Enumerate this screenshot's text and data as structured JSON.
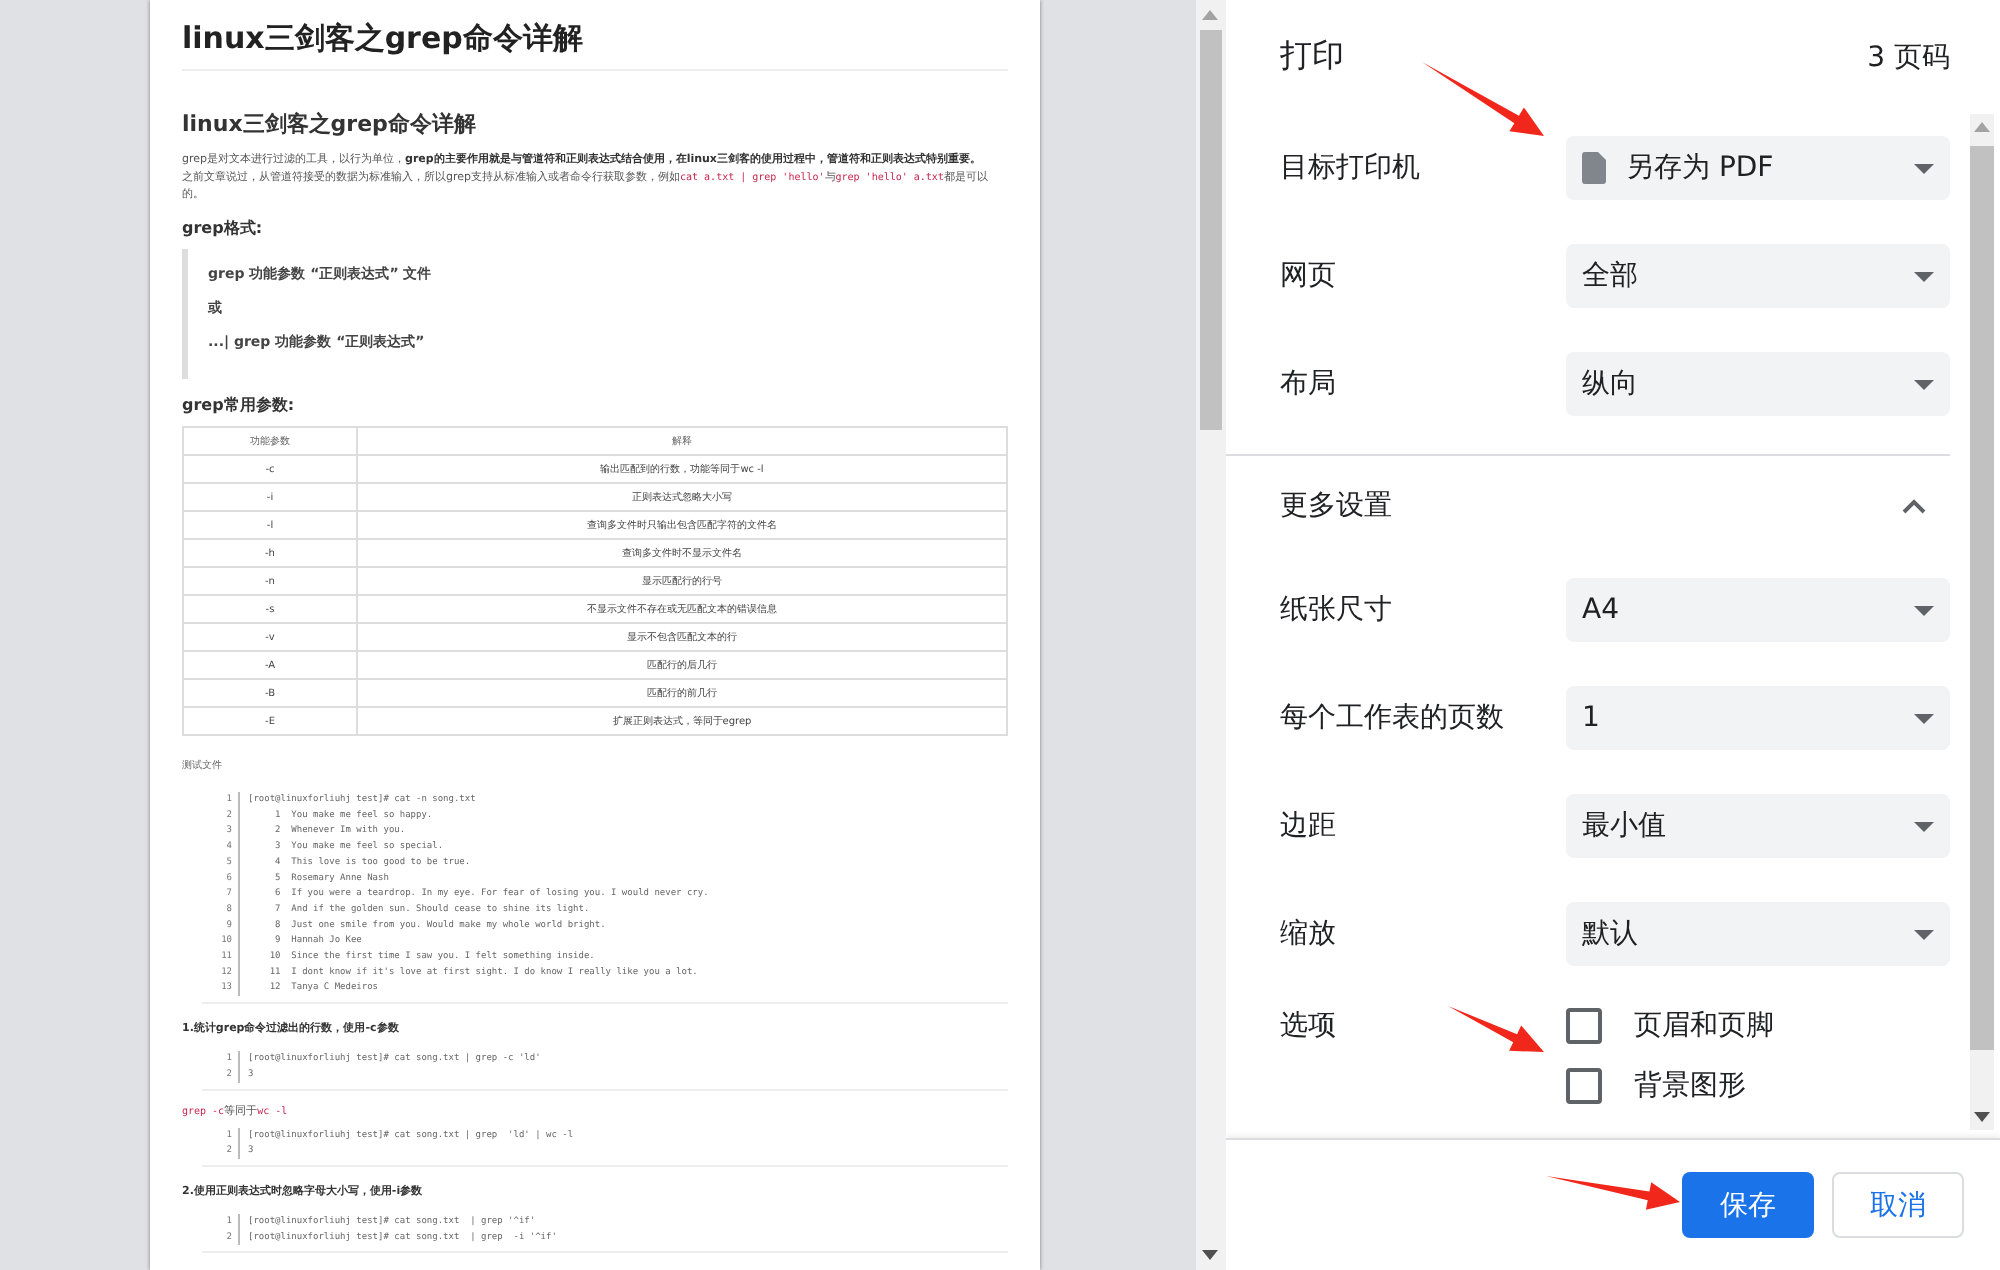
{
  "preview": {
    "title": "linux三剑客之grep命令详解",
    "blocks": [
      {
        "kind": "heading",
        "text": "linux三剑客之grep命令详解"
      },
      {
        "kind": "paragraph",
        "parts": [
          {
            "kind": "text",
            "text": "grep是对文本进行过滤的工具，以行为单位，"
          },
          {
            "kind": "bold",
            "text": "grep的主要作用就是与管道符和正则表达式结合使用，在linux三剑客的使用过程中，管道符和正则表达式特别重要。"
          }
        ]
      },
      {
        "kind": "paragraph",
        "parts": [
          {
            "kind": "text",
            "text": "之前文章说过，从管道符接受的数据为标准输入，所以grep支持从标准输入或者命令行获取参数，例如"
          },
          {
            "kind": "code",
            "text": "cat a.txt | grep 'hello'"
          },
          {
            "kind": "text",
            "text": "与"
          },
          {
            "kind": "code",
            "text": "grep 'hello' a.txt"
          },
          {
            "kind": "text",
            "text": "都是可以的。"
          }
        ]
      },
      {
        "kind": "subheading",
        "text": "grep格式:"
      },
      {
        "kind": "quote",
        "lines": [
          "grep 功能参数 “正则表达式” 文件",
          "或",
          "...| grep 功能参数 “正则表达式”"
        ]
      },
      {
        "kind": "subheading",
        "text": "grep常用参数:"
      },
      {
        "kind": "table",
        "columns": [
          "功能参数",
          "解释"
        ],
        "rows": [
          [
            "-c",
            "输出匹配到的行数，功能等同于wc -l"
          ],
          [
            "-i",
            "正则表达式忽略大小写"
          ],
          [
            "-l",
            "查询多文件时只输出包含匹配字符的文件名"
          ],
          [
            "-h",
            "查询多文件时不显示文件名"
          ],
          [
            "-n",
            "显示匹配行的行号"
          ],
          [
            "-s",
            "不显示文件不存在或无匹配文本的错误信息"
          ],
          [
            "-v",
            "显示不包含匹配文本的行"
          ],
          [
            "-A",
            "匹配行的后几行"
          ],
          [
            "-B",
            "匹配行的前几行"
          ],
          [
            "-E",
            "扩展正则表达式，等同于egrep"
          ]
        ]
      },
      {
        "kind": "caption",
        "text": "测试文件"
      },
      {
        "kind": "code",
        "lines": [
          {
            "n": "1",
            "text": "[root@linuxforliuhj test]# cat -n song.txt"
          },
          {
            "n": "2",
            "text": "     1  You make me feel so happy."
          },
          {
            "n": "3",
            "text": "     2  Whenever Im with you."
          },
          {
            "n": "4",
            "text": "     3  You make me feel so special."
          },
          {
            "n": "5",
            "text": "     4  This love is too good to be true."
          },
          {
            "n": "6",
            "text": "     5  Rosemary Anne Nash"
          },
          {
            "n": "7",
            "text": "     6  If you were a teardrop. In my eye. For fear of losing you. I would never cry."
          },
          {
            "n": "8",
            "text": "     7  And if the golden sun. Should cease to shine its light."
          },
          {
            "n": "9",
            "text": "     8  Just one smile from you. Would make my whole world bright."
          },
          {
            "n": "10",
            "text": "     9  Hannah Jo Kee"
          },
          {
            "n": "11",
            "text": "    10  Since the first time I saw you. I felt something inside."
          },
          {
            "n": "12",
            "text": "    11  I dont know if it's love at first sight. I do know I really like you a lot."
          },
          {
            "n": "13",
            "text": "    12  Tanya C Medeiros"
          }
        ]
      },
      {
        "kind": "step",
        "text": "1.统计grep命令过滤出的行数，使用-c参数"
      },
      {
        "kind": "code",
        "lines": [
          {
            "n": "1",
            "text": "[root@linuxforliuhj test]# cat song.txt | grep -c 'ld'"
          },
          {
            "n": "2",
            "text": "3"
          }
        ]
      },
      {
        "kind": "paragraph",
        "parts": [
          {
            "kind": "code",
            "text": "grep -c"
          },
          {
            "kind": "text",
            "text": "等同于"
          },
          {
            "kind": "code",
            "text": "wc -l"
          }
        ]
      },
      {
        "kind": "code",
        "lines": [
          {
            "n": "1",
            "text": "[root@linuxforliuhj test]# cat song.txt | grep  'ld' | wc -l"
          },
          {
            "n": "2",
            "text": "3"
          }
        ]
      },
      {
        "kind": "step",
        "text": "2.使用正则表达式时忽略字母大小写，使用-i参数"
      },
      {
        "kind": "code",
        "lines": [
          {
            "n": "1",
            "text": "[root@linuxforliuhj test]# cat song.txt  | grep '^if'"
          },
          {
            "n": "2",
            "text": "[root@linuxforliuhj test]# cat song.txt  | grep  -i '^if'"
          }
        ]
      }
    ]
  },
  "settings": {
    "title": "打印",
    "page_count": "3 页码",
    "rows": [
      {
        "kind": "printer-select",
        "label": "目标打印机",
        "value": "另存为 PDF"
      },
      {
        "kind": "select",
        "label": "网页",
        "value": "全部"
      },
      {
        "kind": "select",
        "label": "布局",
        "value": "纵向"
      }
    ],
    "more": {
      "label": "更多设置",
      "expanded": true
    },
    "more_rows": [
      {
        "kind": "select",
        "label": "纸张尺寸",
        "value": "A4"
      },
      {
        "kind": "select",
        "label": "每个工作表的页数",
        "value": "1"
      },
      {
        "kind": "select",
        "label": "边距",
        "value": "最小值"
      },
      {
        "kind": "select",
        "label": "缩放",
        "value": "默认"
      },
      {
        "kind": "checkboxes",
        "label": "选项",
        "options": [
          {
            "label": "页眉和页脚",
            "checked": false
          },
          {
            "label": "背景图形",
            "checked": false
          }
        ]
      }
    ]
  },
  "buttons": [
    {
      "label": "保存",
      "kind": "primary"
    },
    {
      "label": "取消",
      "kind": "secondary"
    }
  ]
}
